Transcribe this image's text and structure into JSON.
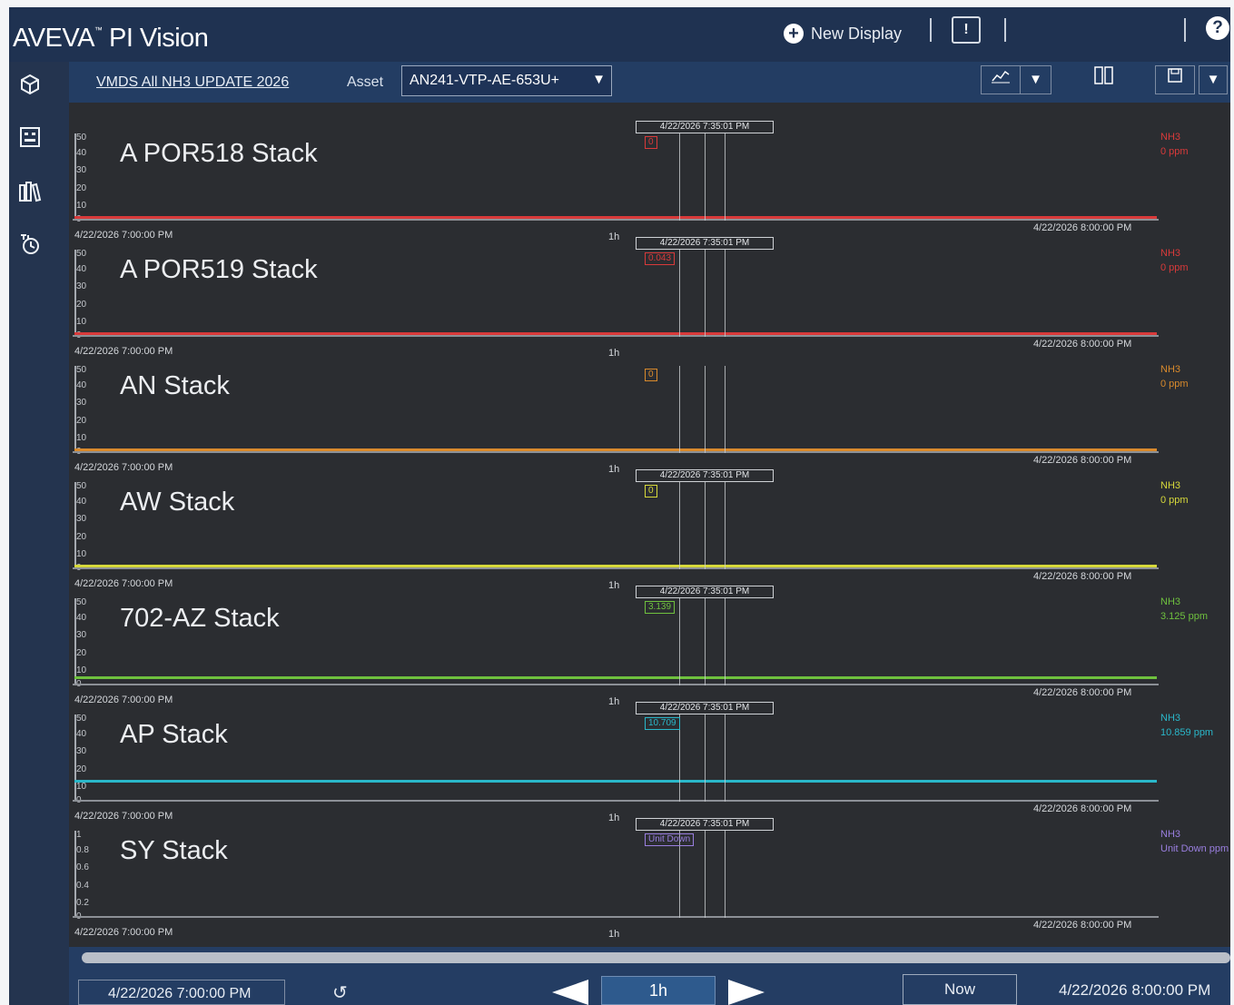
{
  "header": {
    "brand_main": "AVEVA",
    "brand_tm": "™",
    "brand_product": " PI Vision",
    "new_display_label": "New Display"
  },
  "toolbar": {
    "display_name": "VMDS All NH3 UPDATE 2026",
    "asset_label": "Asset",
    "asset_value": "AN241-VTP-AE-653U+"
  },
  "panels": [
    {
      "title": "A POR518 Stack",
      "color": "#d93a3a",
      "yticks": [
        "50",
        "40",
        "30",
        "20",
        "10",
        "0"
      ],
      "start": "4/22/2026 7:00:00 PM",
      "end": "4/22/2026 8:00:00 PM",
      "span": "1h",
      "cursor_time": "4/22/2026 7:35:01 PM",
      "cursor_value": "0",
      "legend_name": "NH3",
      "legend_value": "0 ppm",
      "level": 0
    },
    {
      "title": "A POR519 Stack",
      "color": "#d93a3a",
      "yticks": [
        "50",
        "40",
        "30",
        "20",
        "10",
        "0"
      ],
      "start": "4/22/2026 7:00:00 PM",
      "end": "4/22/2026 8:00:00 PM",
      "span": "1h",
      "cursor_time": "4/22/2026 7:35:01 PM",
      "cursor_value": "0.043",
      "legend_name": "NH3",
      "legend_value": "0 ppm",
      "level": 0
    },
    {
      "title": "AN Stack",
      "color": "#d98a2c",
      "yticks": [
        "50",
        "40",
        "30",
        "20",
        "10",
        "0"
      ],
      "start": "4/22/2026 7:00:00 PM",
      "end": "4/22/2026 8:00:00 PM",
      "span": "1h",
      "cursor_time": "",
      "cursor_value": "0",
      "legend_name": "NH3",
      "legend_value": "0 ppm",
      "level": 0
    },
    {
      "title": "AW Stack",
      "color": "#d7d93a",
      "yticks": [
        "50",
        "40",
        "30",
        "20",
        "10",
        "0"
      ],
      "start": "4/22/2026 7:00:00 PM",
      "end": "4/22/2026 8:00:00 PM",
      "span": "1h",
      "cursor_time": "4/22/2026 7:35:01 PM",
      "cursor_value": "0",
      "legend_name": "NH3",
      "legend_value": "0 ppm",
      "level": 0
    },
    {
      "title": "702-AZ Stack",
      "color": "#6fc13e",
      "yticks": [
        "50",
        "40",
        "30",
        "20",
        "10",
        "0"
      ],
      "start": "4/22/2026 7:00:00 PM",
      "end": "4/22/2026 8:00:00 PM",
      "span": "1h",
      "cursor_time": "4/22/2026 7:35:01 PM",
      "cursor_value": "3.139",
      "legend_name": "NH3",
      "legend_value": "3.125 ppm",
      "level": 3.1
    },
    {
      "title": "AP Stack",
      "color": "#2ab7c9",
      "yticks": [
        "50",
        "40",
        "30",
        "20",
        "10",
        "0"
      ],
      "start": "4/22/2026 7:00:00 PM",
      "end": "4/22/2026 8:00:00 PM",
      "span": "1h",
      "cursor_time": "4/22/2026 7:35:01 PM",
      "cursor_value": "10.709",
      "legend_name": "NH3",
      "legend_value": "10.859 ppm",
      "level": 10.8
    },
    {
      "title": "SY Stack",
      "color": "#9a7fe0",
      "yticks": [
        "1",
        "0.8",
        "0.6",
        "0.4",
        "0.2",
        "0"
      ],
      "start": "4/22/2026 7:00:00 PM",
      "end": "4/22/2026 8:00:00 PM",
      "span": "1h",
      "cursor_time": "4/22/2026 7:35:01 PM",
      "cursor_value": "Unit Down",
      "legend_name": "NH3",
      "legend_value": "Unit Down ppm",
      "level": null
    }
  ],
  "timebar": {
    "start": "4/22/2026 7:00:00 PM",
    "duration": "1h",
    "now_label": "Now",
    "end": "4/22/2026 8:00:00 PM"
  },
  "icons": {
    "left_nav": [
      "cube-icon",
      "display-grid-icon",
      "library-icon",
      "event-frame-clock-icon"
    ],
    "header": [
      "plus-circle-icon",
      "info-icon",
      "help-icon"
    ],
    "toolbar": [
      "trend-icon",
      "dropdown-icon",
      "columns-icon",
      "save-icon"
    ]
  }
}
